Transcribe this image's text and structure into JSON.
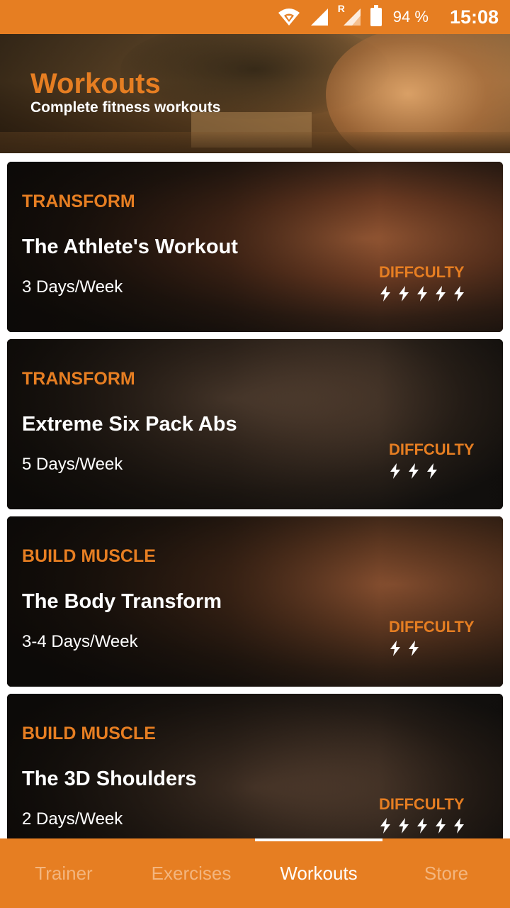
{
  "status_bar": {
    "battery_pct": "94 %",
    "time": "15:08",
    "network_label": "R"
  },
  "header": {
    "title": "Workouts",
    "subtitle": "Complete fitness workouts"
  },
  "cards": [
    {
      "category": "TRANSFORM",
      "title": "The Athlete's Workout",
      "schedule": "3 Days/Week",
      "difficulty_label": "DIFFCULTY",
      "difficulty_level": 5
    },
    {
      "category": "TRANSFORM",
      "title": "Extreme Six Pack Abs",
      "schedule": "5 Days/Week",
      "difficulty_label": "DIFFCULTY",
      "difficulty_level": 3
    },
    {
      "category": "BUILD MUSCLE",
      "title": "The Body Transform",
      "schedule": "3-4 Days/Week",
      "difficulty_label": "DIFFCULTY",
      "difficulty_level": 2
    },
    {
      "category": "BUILD MUSCLE",
      "title": "The 3D Shoulders",
      "schedule": "2 Days/Week",
      "difficulty_label": "DIFFCULTY",
      "difficulty_level": 5
    }
  ],
  "bottom_nav": {
    "tabs": [
      {
        "label": "Trainer",
        "active": false
      },
      {
        "label": "Exercises",
        "active": false
      },
      {
        "label": "Workouts",
        "active": true
      },
      {
        "label": "Store",
        "active": false
      }
    ]
  },
  "colors": {
    "accent": "#e67e22",
    "text_light": "#ffffff",
    "inactive_tab": "#f3b57e"
  },
  "icons": {
    "difficulty": "lightning-bolt-icon",
    "wifi": "wifi-icon",
    "signal": "cell-signal-icon",
    "battery": "battery-icon"
  }
}
